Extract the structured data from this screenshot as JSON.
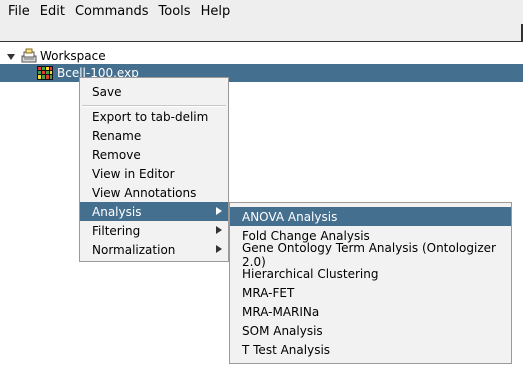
{
  "menubar": {
    "items": [
      "File",
      "Edit",
      "Commands",
      "Tools",
      "Help"
    ]
  },
  "tree": {
    "root": {
      "label": "Workspace",
      "icon": "workspace-icon",
      "expanded": true
    },
    "child": {
      "label": "Bcell-100.exp",
      "icon": "heatmap-icon",
      "selected": true
    }
  },
  "context_menu": {
    "items": [
      {
        "label": "Save",
        "separator_after": true
      },
      {
        "label": "Export to tab-delim"
      },
      {
        "label": "Rename"
      },
      {
        "label": "Remove"
      },
      {
        "label": "View in Editor"
      },
      {
        "label": "View Annotations"
      },
      {
        "label": "Analysis",
        "submenu": true,
        "selected": true
      },
      {
        "label": "Filtering",
        "submenu": true
      },
      {
        "label": "Normalization",
        "submenu": true
      }
    ]
  },
  "analysis_submenu": {
    "items": [
      {
        "label": "ANOVA Analysis",
        "selected": true
      },
      {
        "label": "Fold Change Analysis"
      },
      {
        "label": "Gene Ontology Term Analysis (Ontologizer 2.0)"
      },
      {
        "label": "Hierarchical Clustering"
      },
      {
        "label": "MRA-FET"
      },
      {
        "label": "MRA-MARINa"
      },
      {
        "label": "SOM Analysis"
      },
      {
        "label": "T Test Analysis"
      }
    ]
  },
  "colors": {
    "selection": "#456f8f",
    "menu_bg": "#f2f2f2",
    "chrome_bg": "#eeeeee"
  }
}
